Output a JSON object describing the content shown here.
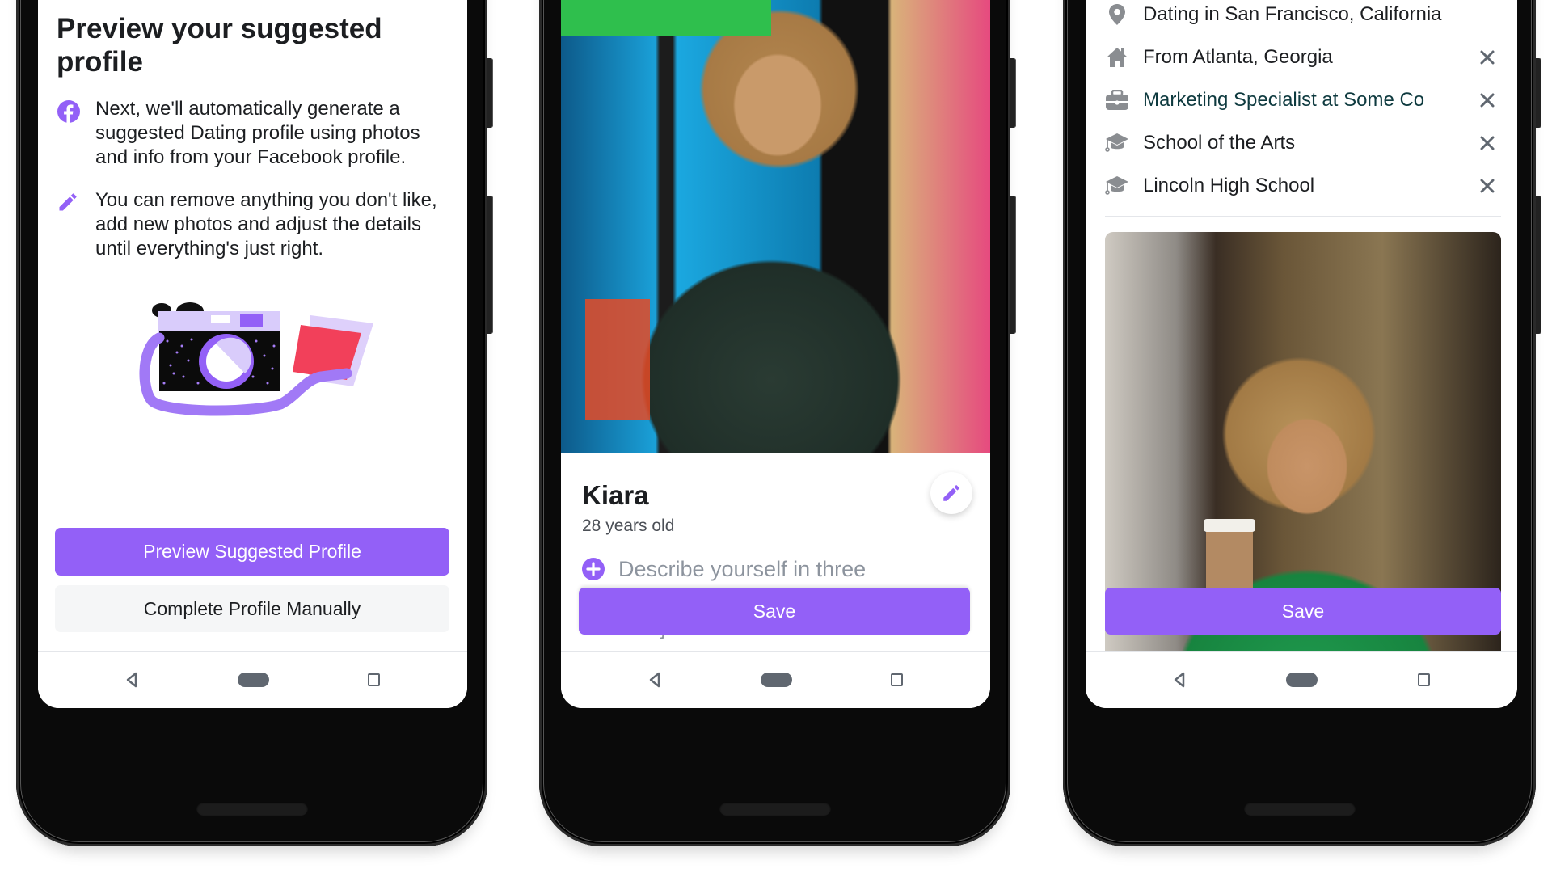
{
  "accent_color": "#9360f7",
  "phones": {
    "onboarding": {
      "title": "Preview your suggested profile",
      "info": [
        {
          "icon": "facebook-icon",
          "text": "Next, we'll automatically generate a suggested Dating profile using photos and info from your Facebook profile."
        },
        {
          "icon": "pencil-icon",
          "text": "You can remove anything you don't like, add new photos and adjust the details until everything's just right."
        }
      ],
      "illustration": "camera-illustration",
      "primary_button": "Preview Suggested Profile",
      "secondary_button": "Complete Profile Manually"
    },
    "profile": {
      "name": "Kiara",
      "age": "28 years old",
      "bio_placeholder": "Describe yourself in three sentences, three words or three emojis.",
      "save_button": "Save"
    },
    "details": {
      "items": [
        {
          "icon": "location-pin-icon",
          "text": "Dating in San Francisco, California",
          "removable": false
        },
        {
          "icon": "home-icon",
          "text": "From Atlanta, Georgia",
          "removable": true
        },
        {
          "icon": "briefcase-icon",
          "text": "Marketing Specialist at Some Co",
          "removable": true
        },
        {
          "icon": "graduation-cap-icon",
          "text": "School of the Arts",
          "removable": true
        },
        {
          "icon": "graduation-cap-icon",
          "text": "Lincoln High School",
          "removable": true
        }
      ],
      "save_button": "Save"
    }
  },
  "navbar": {
    "back": "back-icon",
    "home": "home-pill-icon",
    "recents": "recents-icon"
  }
}
